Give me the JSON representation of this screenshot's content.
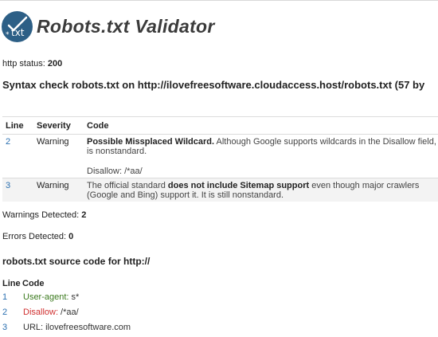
{
  "app": {
    "title": "Robots.txt Validator",
    "logo_text": "txt"
  },
  "status": {
    "label": "http status:",
    "value": "200"
  },
  "syntax": {
    "heading": "Syntax check robots.txt on http://ilovefreesoftware.cloudaccess.host/robots.txt (57 by"
  },
  "issues": {
    "headers": [
      "Line",
      "Severity",
      "Code"
    ],
    "rows": [
      {
        "line": "2",
        "severity": "Warning",
        "code_bold": "Possible Missplaced Wildcard.",
        "code_text": " Although Google supports wildcards in the Disallow field, it is nonstandard.",
        "code_extra": "Disallow: /*aa/"
      },
      {
        "line": "3",
        "severity": "Warning",
        "code_prefix": "The official standard ",
        "code_bold": "does not include Sitemap support",
        "code_text": " even though major crawlers (Google and Bing) support it. It is still nonstandard."
      }
    ]
  },
  "summary": {
    "warnings_label": "Warnings Detected:",
    "warnings_value": "2",
    "errors_label": "Errors Detected:",
    "errors_value": "0"
  },
  "source": {
    "heading": "robots.txt source code for http://",
    "headers": [
      "Line",
      "Code"
    ],
    "rows": [
      {
        "line": "1",
        "key": "User-agent:",
        "value": "s*"
      },
      {
        "line": "2",
        "key": "Disallow:",
        "value": "/*aa/"
      },
      {
        "line": "3",
        "key": "URL:",
        "value": "ilovefreesoftware.com"
      }
    ]
  },
  "colors": {
    "logo_bg": "#2d5f86",
    "link": "#2a6fb0",
    "user_agent": "#3b7a1e",
    "disallow": "#d03030"
  }
}
